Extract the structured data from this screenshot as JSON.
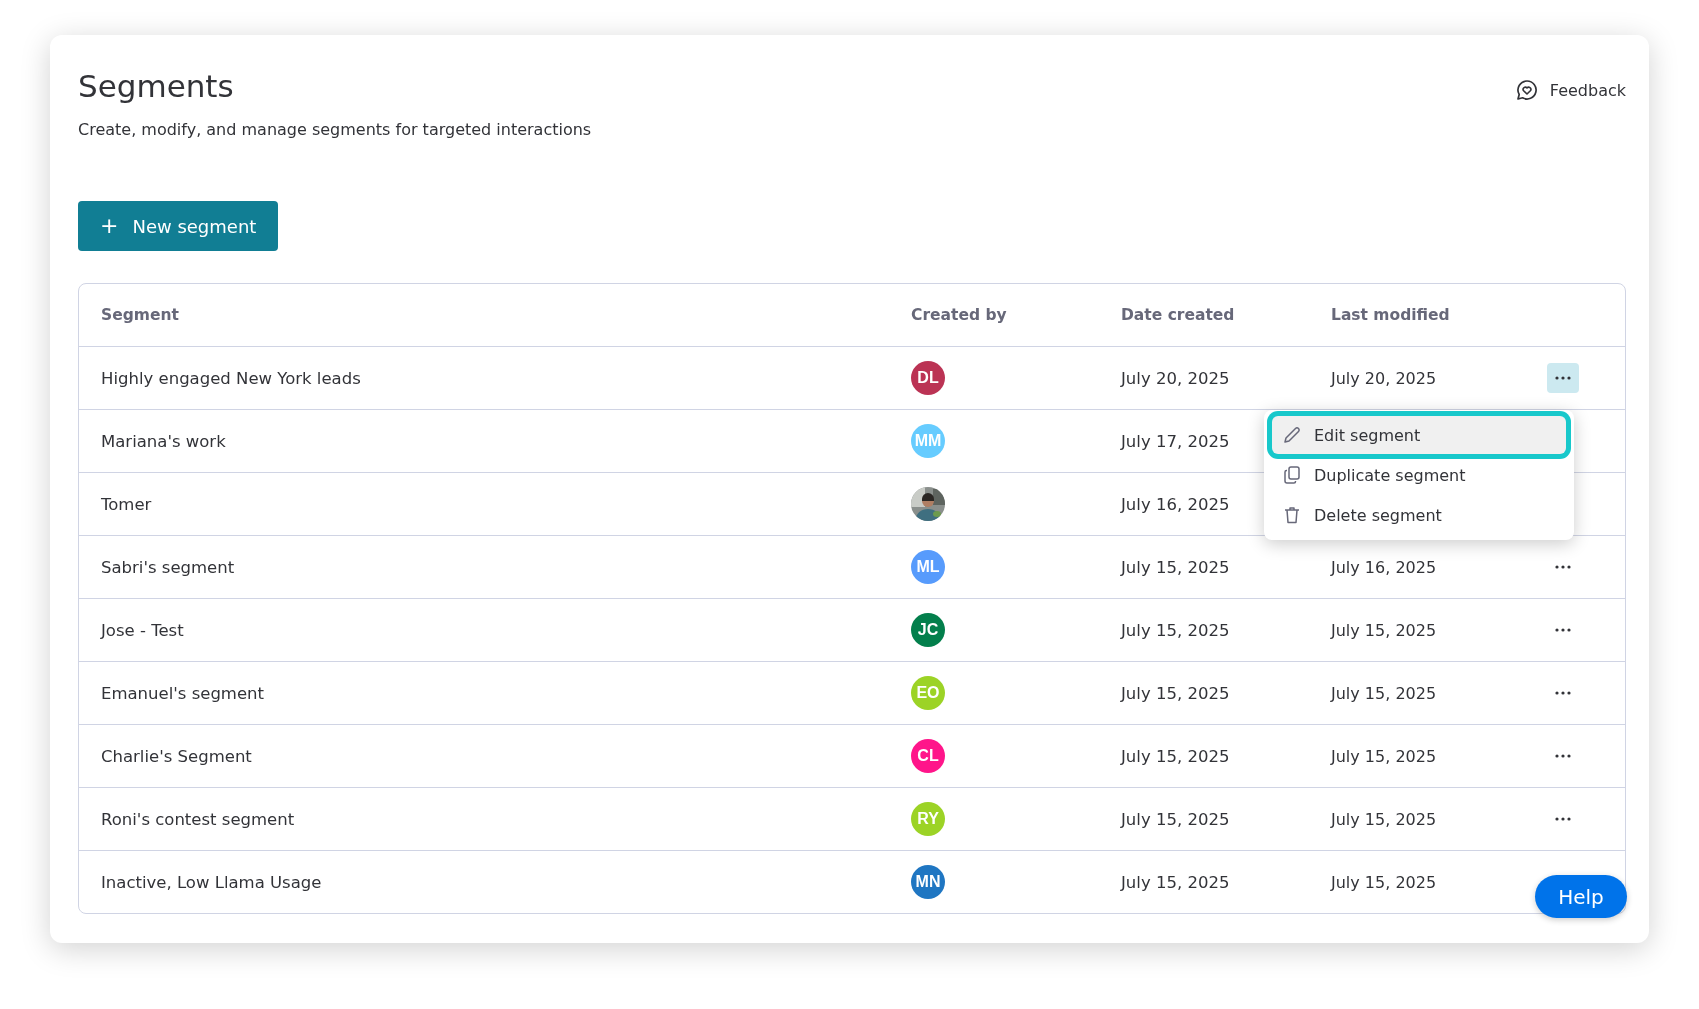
{
  "header": {
    "title": "Segments",
    "subtitle": "Create, modify, and manage segments for targeted interactions",
    "feedback": "Feedback"
  },
  "new_button": {
    "label": "+",
    "text": "New segment"
  },
  "table": {
    "columns": [
      "Segment",
      "Created by",
      "Date created",
      "Last modified"
    ],
    "rows": [
      {
        "name": "Highly engaged New York leads",
        "avatar": {
          "kind": "initials",
          "initials": "DL",
          "color": "#bb3354"
        },
        "date_created": "July 20, 2025",
        "last_modified": "July 20, 2025",
        "more_button_active": true
      },
      {
        "name": "Mariana's work",
        "avatar": {
          "kind": "initials",
          "initials": "MM",
          "color": "#66ccff"
        },
        "date_created": "July 17, 2025"
      },
      {
        "name": "Tomer",
        "date_created": "July 16, 2025"
      },
      {
        "name": "Sabri's segment",
        "avatar": {
          "kind": "initials",
          "initials": "ML",
          "color": "#579bfc"
        },
        "date_created": "July 15, 2025",
        "last_modified": "July 16, 2025",
        "more_button_active": false
      },
      {
        "name": "Jose - Test",
        "avatar": {
          "kind": "initials",
          "initials": "JC",
          "color": "#037f4c"
        },
        "date_created": "July 15, 2025",
        "last_modified": "July 15, 2025",
        "more_button_active": false
      },
      {
        "name": "Emanuel's segment",
        "avatar": {
          "kind": "initials",
          "initials": "EO",
          "color": "#9cd326"
        },
        "date_created": "July 15, 2025",
        "last_modified": "July 15, 2025",
        "more_button_active": false
      },
      {
        "name": "Charlie's Segment",
        "avatar": {
          "kind": "initials",
          "initials": "CL",
          "color": "#ff158a"
        },
        "date_created": "July 15, 2025",
        "last_modified": "July 15, 2025",
        "more_button_active": false
      },
      {
        "name": "Roni's contest segment",
        "avatar": {
          "kind": "initials",
          "initials": "RY",
          "color": "#9cd326"
        },
        "date_created": "July 15, 2025",
        "last_modified": "July 15, 2025",
        "more_button_active": false
      },
      {
        "name": "Inactive, Low Llama Usage",
        "avatar": {
          "kind": "initials",
          "initials": "MN",
          "color": "#1f76c2"
        },
        "date_created": "July 15, 2025",
        "last_modified": "July 15, 2025"
      }
    ]
  },
  "menu": {
    "items": [
      {
        "kind": "edit",
        "label": "Edit segment",
        "selected": true
      },
      {
        "kind": "duplicate",
        "label": "Duplicate segment",
        "selected": false
      },
      {
        "kind": "delete",
        "label": "Delete segment",
        "selected": false
      }
    ]
  },
  "help": {
    "label": "Help"
  }
}
